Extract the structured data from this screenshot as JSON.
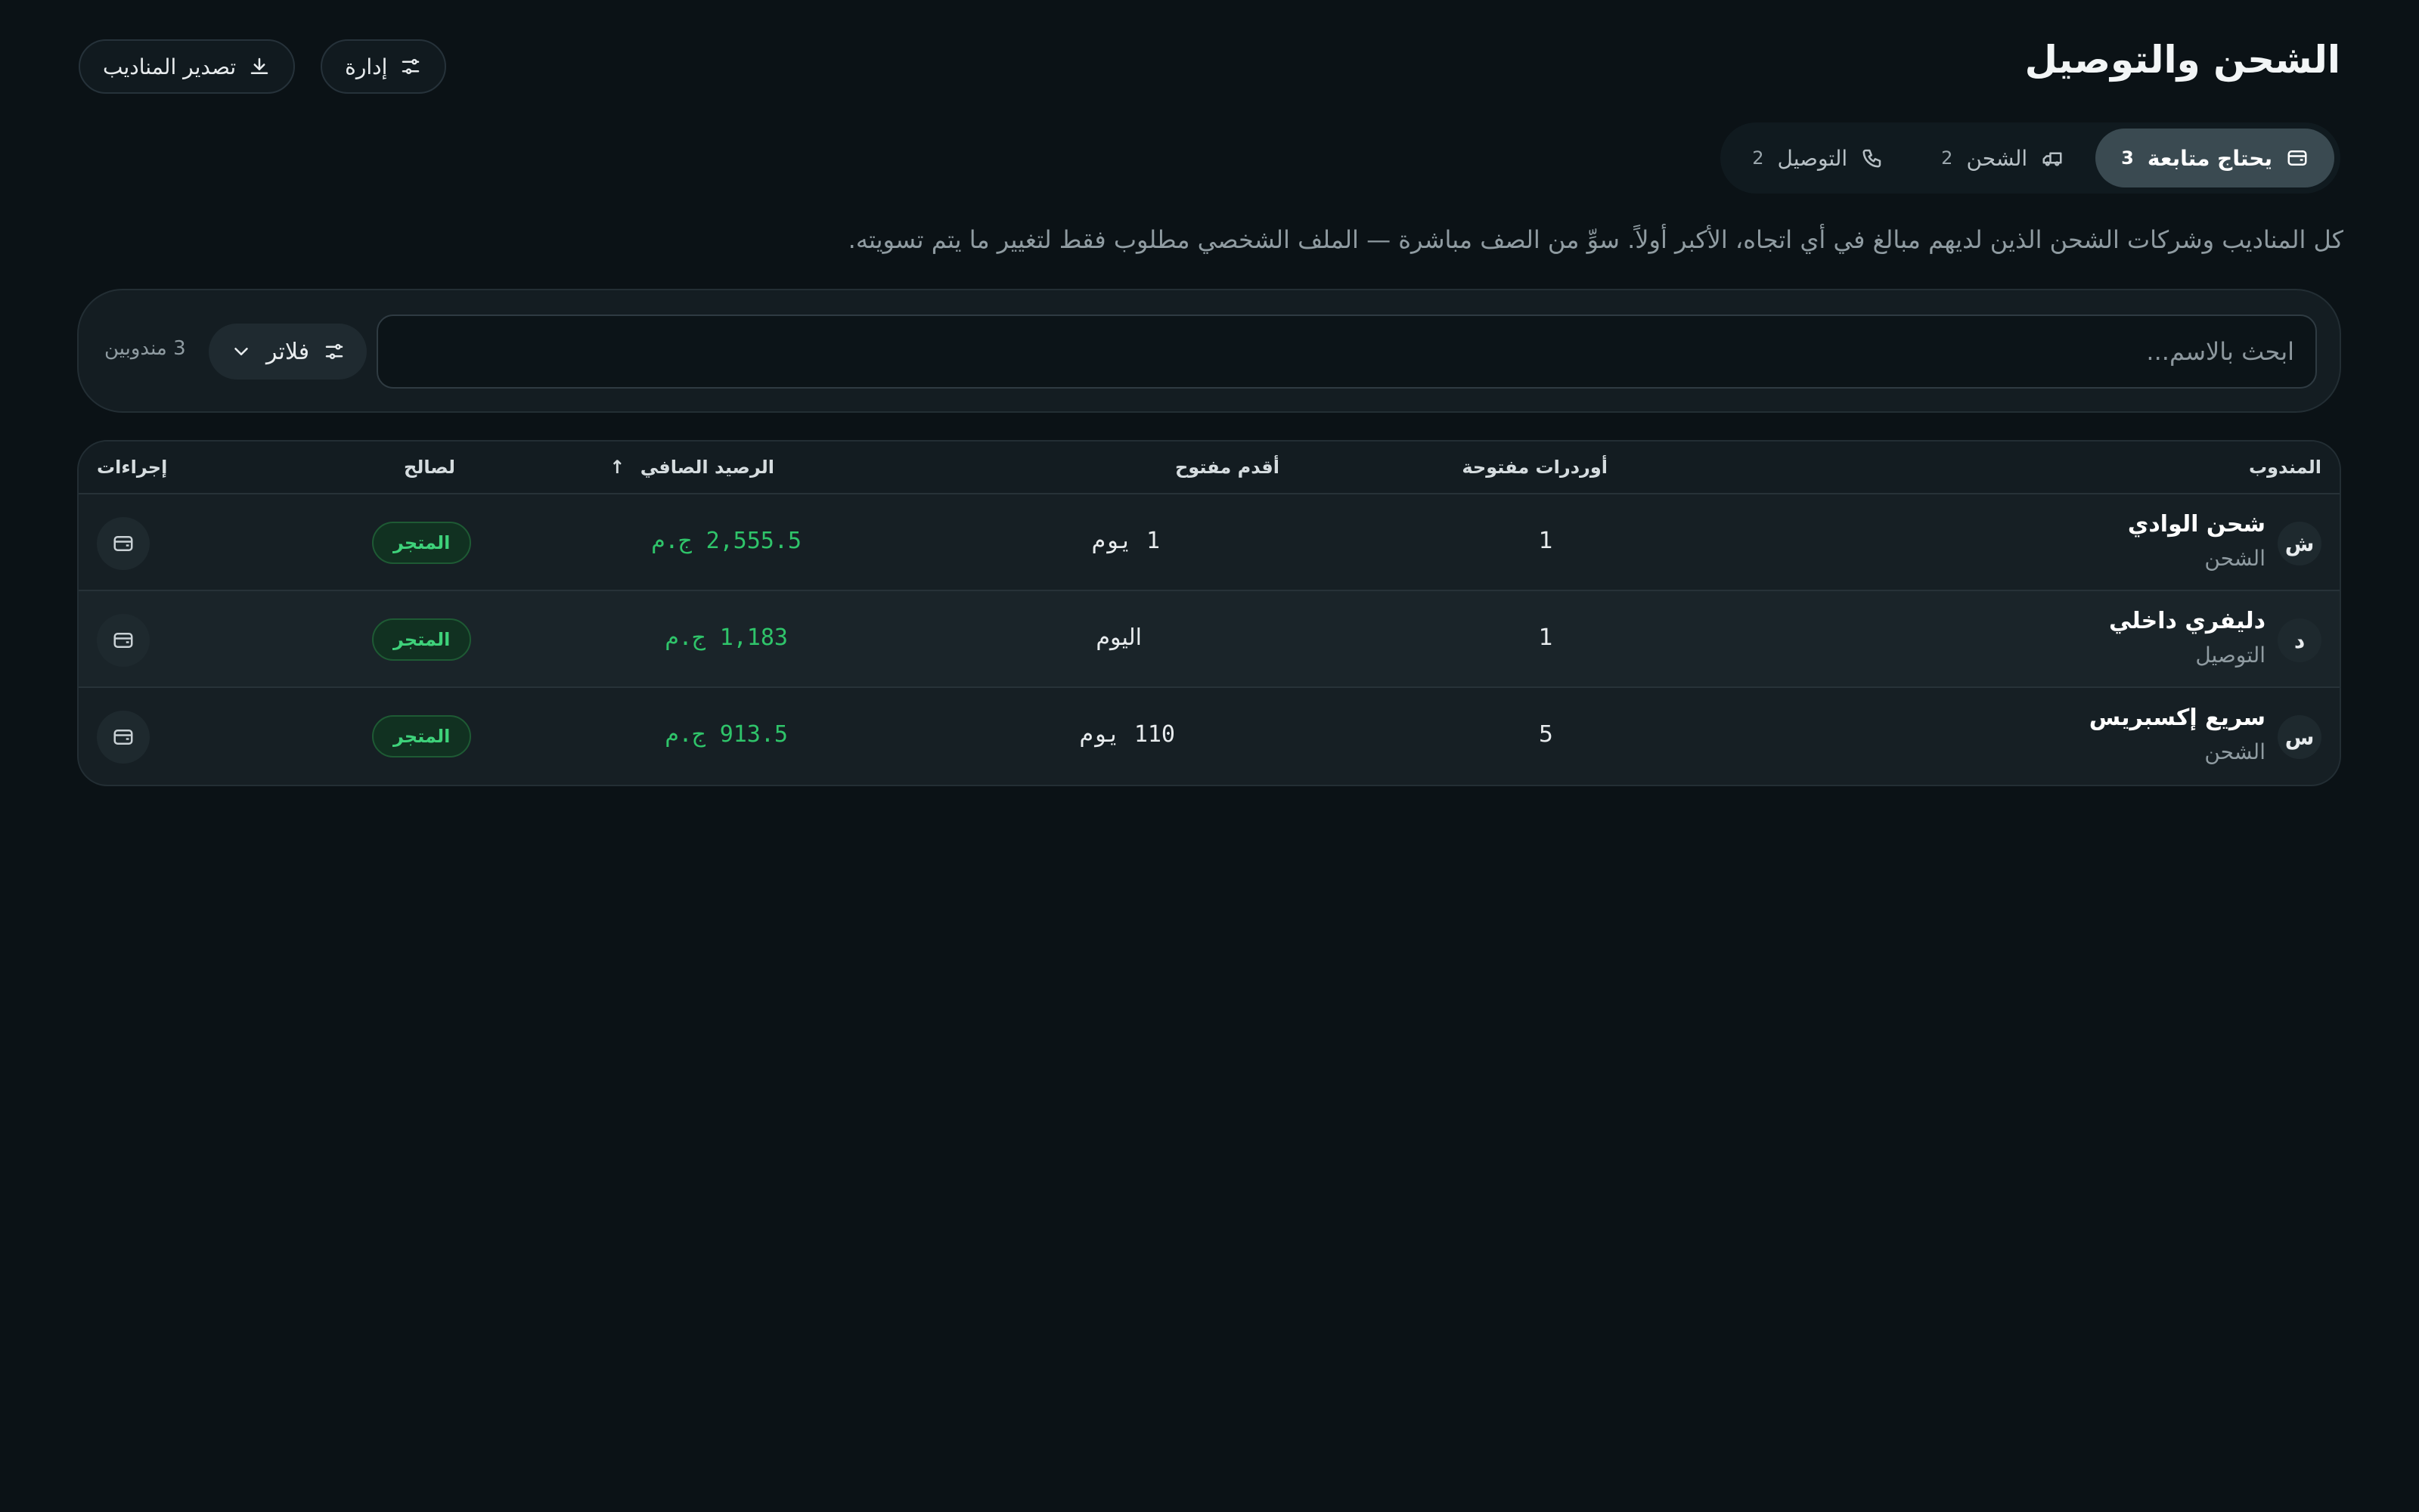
{
  "header": {
    "title": "الشحن والتوصيل",
    "export_label": "تصدير المناديب",
    "manage_label": "إدارة"
  },
  "tabs": [
    {
      "label": "يحتاج متابعة",
      "count": "3",
      "icon": "wallet-icon",
      "active": true
    },
    {
      "label": "الشحن",
      "count": "2",
      "icon": "truck-icon",
      "active": false
    },
    {
      "label": "التوصيل",
      "count": "2",
      "icon": "phone-icon",
      "active": false
    }
  ],
  "description": "كل المناديب وشركات الشحن الذين لديهم مبالغ في أي اتجاه، الأكبر أولاً. سوِّ من الصف مباشرة — الملف الشخصي مطلوب فقط لتغيير ما يتم تسويته.",
  "search": {
    "placeholder": "ابحث بالاسم...",
    "filter_label": "فلاتر",
    "result_count": "3 مندوبين"
  },
  "table": {
    "columns": {
      "rep": "المندوب",
      "open_orders": "أوردرات  مفتوحة",
      "oldest_open": "أقدم مفتوح",
      "net_balance": "الرصيد  الصافي",
      "sort_indicator": "↑",
      "in_favor_of": "لصالح",
      "actions": "إجراءات"
    },
    "rows": [
      {
        "initial": "ش",
        "name": "شحن الوادي",
        "type": "الشحن",
        "open_orders": "1",
        "oldest": "1 يوم",
        "balance": "2,555.5 ج.م",
        "favor": "المتجر"
      },
      {
        "initial": "د",
        "name": "دليفري داخلي",
        "type": "التوصيل",
        "open_orders": "1",
        "oldest": "اليوم",
        "balance": "1,183 ج.م",
        "favor": "المتجر"
      },
      {
        "initial": "س",
        "name": "سريع إكسبريس",
        "type": "الشحن",
        "open_orders": "5",
        "oldest": "110 يوم",
        "balance": "913.5 ج.م",
        "favor": "المتجر"
      }
    ]
  },
  "colors": {
    "background": "#0b1216",
    "positive_balance": "#2fc46a",
    "badge_text": "#3ed17a"
  }
}
